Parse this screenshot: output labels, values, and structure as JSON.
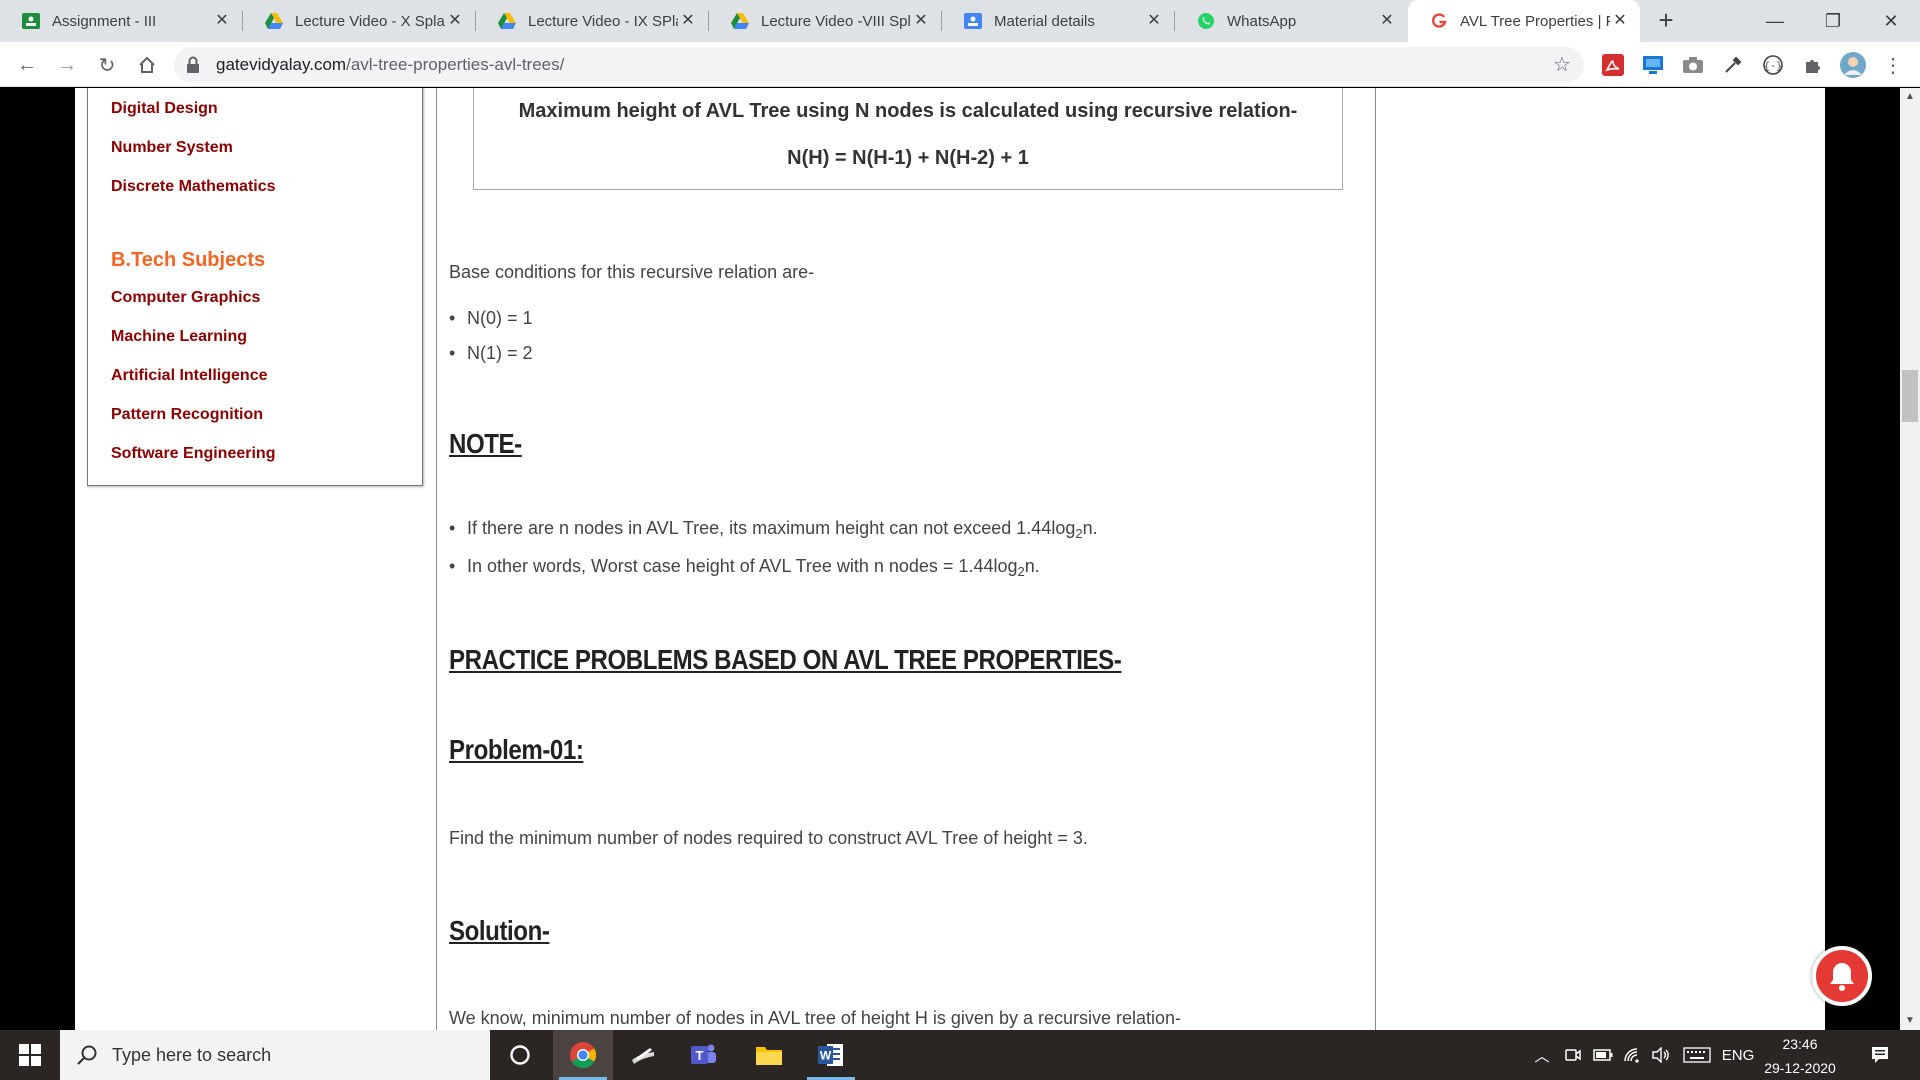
{
  "browser": {
    "tabs": [
      {
        "title": "Assignment - III",
        "icon": "classroom-icon",
        "active": false
      },
      {
        "title": "Lecture Video - X Splay",
        "icon": "google-drive-icon",
        "active": false
      },
      {
        "title": "Lecture Video - IX SPlay",
        "icon": "google-drive-icon",
        "active": false
      },
      {
        "title": "Lecture Video -VIII Splay",
        "icon": "google-drive-icon",
        "active": false
      },
      {
        "title": "Material details",
        "icon": "classroom-icon",
        "active": false
      },
      {
        "title": "WhatsApp",
        "icon": "whatsapp-icon",
        "active": true
      },
      {
        "title": "AVL Tree Properties | Problems",
        "icon": "gatevidyalay-icon",
        "active": false
      }
    ],
    "new_tab": "+",
    "url_host": "gatevidyalay.com",
    "url_path": "/avl-tree-properties-avl-trees/"
  },
  "sidebar": {
    "top_links": [
      "Digital Design",
      "Number System",
      "Discrete Mathematics"
    ],
    "heading": "B.Tech Subjects",
    "links": [
      "Computer Graphics",
      "Machine Learning",
      "Artificial Intelligence",
      "Pattern Recognition",
      "Software Engineering"
    ]
  },
  "article": {
    "formula_intro": "Maximum height of AVL Tree using N nodes is calculated using recursive relation-",
    "formula": "N(H) = N(H-1) + N(H-2) + 1",
    "base_intro": "Base conditions for this recursive relation are-",
    "base_conditions": [
      "N(0) = 1",
      "N(1) = 2"
    ],
    "note_heading": "NOTE-",
    "note_1_a": "If there are n nodes in AVL Tree, its maximum height can not exceed 1.44log",
    "note_1_sub": "2",
    "note_1_b": "n.",
    "note_2_a": "In other words, Worst case height of AVL Tree with n nodes = 1.44log",
    "note_2_sub": "2",
    "note_2_b": "n.",
    "practice_heading": "PRACTICE PROBLEMS BASED ON AVL TREE PROPERTIES-",
    "problem_heading": "Problem-01:",
    "problem_text": "Find the minimum number of nodes required to construct AVL Tree of height = 3.",
    "solution_heading": "Solution-",
    "solution_text": "We know, minimum number of nodes in AVL tree of height H is given by a recursive relation-"
  },
  "taskbar": {
    "search_placeholder": "Type here to search",
    "language": "ENG",
    "time": "23:46",
    "date": "29-12-2020"
  },
  "colors": {
    "sidebar_link": "#8b0000",
    "sidebar_heading": "#f26522",
    "notification": "#e53935"
  }
}
